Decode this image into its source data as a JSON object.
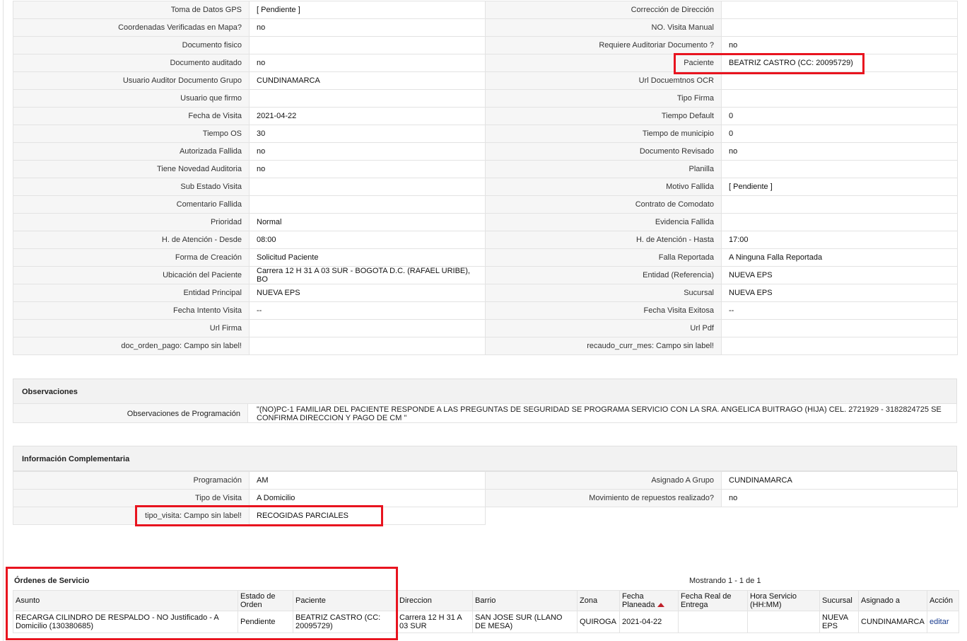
{
  "details": [
    {
      "l1": "Toma de Datos GPS",
      "v1": "[ Pendiente ]",
      "l2": "Corrección de Dirección",
      "v2": ""
    },
    {
      "l1": "Coordenadas Verificadas en Mapa?",
      "v1": " no",
      "l2": "NO. Visita Manual",
      "v2": ""
    },
    {
      "l1": "Documento fisico",
      "v1": "",
      "l2": "Requiere Auditoriar Documento ?",
      "v2": " no"
    },
    {
      "l1": "Documento auditado",
      "v1": " no",
      "l2": "Paciente",
      "v2": "BEATRIZ CASTRO (CC: 20095729)"
    },
    {
      "l1": "Usuario Auditor Documento Grupo",
      "v1": "CUNDINAMARCA",
      "l2": "Url Docuemtnos OCR",
      "v2": ""
    },
    {
      "l1": "Usuario que firmo",
      "v1": "",
      "l2": "Tipo Firma",
      "v2": ""
    },
    {
      "l1": "Fecha de Visita",
      "v1": " 2021-04-22",
      "l2": "Tiempo Default",
      "v2": "0"
    },
    {
      "l1": "Tiempo OS",
      "v1": "30",
      "l2": "Tiempo de municipio",
      "v2": "0"
    },
    {
      "l1": "Autorizada Fallida",
      "v1": " no",
      "l2": "Documento Revisado",
      "v2": " no"
    },
    {
      "l1": "Tiene Novedad Auditoria",
      "v1": " no",
      "l2": "Planilla",
      "v2": ""
    },
    {
      "l1": "Sub Estado Visita",
      "v1": "",
      "l2": "Motivo Fallida",
      "v2": "[ Pendiente ]"
    },
    {
      "l1": "Comentario Fallida",
      "v1": "",
      "l2": "Contrato de Comodato",
      "v2": ""
    },
    {
      "l1": "Prioridad",
      "v1": "Normal",
      "l2": "Evidencia Fallida",
      "v2": ""
    },
    {
      "l1": "H. de Atención - Desde",
      "v1": "08:00",
      "l2": "H. de Atención - Hasta",
      "v2": "17:00"
    },
    {
      "l1": "Forma de Creación",
      "v1": "Solicitud Paciente",
      "l2": "Falla Reportada",
      "v2": "A Ninguna Falla Reportada"
    },
    {
      "l1": "Ubicación del Paciente",
      "v1": "Carrera 12 H 31 A 03 SUR - BOGOTA D.C. (RAFAEL URIBE), BO",
      "l2": "Entidad (Referencia)",
      "v2": "NUEVA EPS"
    },
    {
      "l1": "Entidad Principal",
      "v1": "NUEVA EPS",
      "l2": "Sucursal",
      "v2": "NUEVA EPS"
    },
    {
      "l1": "Fecha Intento Visita",
      "v1": " --",
      "l2": "Fecha Visita Exitosa",
      "v2": " --"
    },
    {
      "l1": "Url Firma",
      "v1": "",
      "l2": "Url Pdf",
      "v2": ""
    },
    {
      "l1": "doc_orden_pago: Campo sin label!",
      "v1": "",
      "l2": "recaudo_curr_mes: Campo sin label!",
      "v2": ""
    }
  ],
  "observaciones": {
    "title": "Observaciones",
    "label": "Observaciones de Programación",
    "value": "\"(NO)PC-1 FAMILIAR DEL PACIENTE RESPONDE A LAS PREGUNTAS DE SEGURIDAD SE PROGRAMA SERVICIO CON LA SRA. ANGELICA BUITRAGO (HIJA) CEL. 2721929 - 3182824725 SE CONFIRMA DIRECCION Y PAGO DE CM \""
  },
  "complementaria": {
    "title": "Información Complementaria",
    "rows": [
      {
        "l1": "Programación",
        "v1": "AM",
        "l2": "Asignado A Grupo",
        "v2": "CUNDINAMARCA"
      },
      {
        "l1": "Tipo de Visita",
        "v1": "A Domicilio",
        "l2": "Movimiento de repuestos realizado?",
        "v2": " no"
      },
      {
        "l1": "tipo_visita: Campo sin label!",
        "v1": "RECOGIDAS PARCIALES"
      }
    ]
  },
  "ordenes": {
    "title": "Órdenes de Servicio",
    "mostrando": "Mostrando 1 - 1 de 1",
    "headers": {
      "asunto": "Asunto",
      "estado": "Estado de Orden",
      "paciente": "Paciente",
      "direccion": "Direccion",
      "barrio": "Barrio",
      "zona": "Zona",
      "fecha_planeada": "Fecha Planeada",
      "fecha_real": "Fecha Real de Entrega",
      "hora": "Hora Servicio (HH:MM)",
      "sucursal": "Sucursal",
      "asignado": "Asignado a",
      "accion": "Acción"
    },
    "row": {
      "asunto": "RECARGA CILINDRO DE RESPALDO - NO Justificado - A Domicilio (130380685)",
      "estado": "Pendiente",
      "paciente": "BEATRIZ CASTRO (CC: 20095729)",
      "direccion": "Carrera 12 H 31 A 03 SUR",
      "barrio": "SAN JOSE SUR (LLANO DE MESA)",
      "zona": "QUIROGA",
      "fecha_planeada": "2021-04-22",
      "fecha_real": "",
      "hora": "",
      "sucursal": "NUEVA EPS",
      "asignado": "CUNDINAMARCA",
      "accion": "editar"
    }
  }
}
